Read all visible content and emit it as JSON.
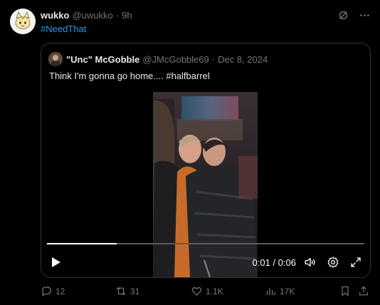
{
  "tweet": {
    "author_name": "wukko",
    "author_handle": "@uwukko",
    "separator": "·",
    "time": "9h",
    "text": "#NeedThat"
  },
  "quoted": {
    "author_name": "\"Unc\" McGobble",
    "author_handle": "@JMcGobble69",
    "separator": "·",
    "date": "Dec 8, 2024",
    "text": "Think I'm gonna go home.... #halfbarrel"
  },
  "video": {
    "time_display": "0:01 / 0:06",
    "progress": 0.22,
    "icons": [
      "play-icon",
      "volume-icon",
      "settings-icon",
      "fullscreen-icon"
    ]
  },
  "actions": {
    "replies": "12",
    "reposts": "31",
    "likes": "1.1K",
    "views": "17K"
  },
  "colors": {
    "background": "#000000",
    "text": "#e7e9ea",
    "muted": "#71767b",
    "link": "#1d9bf0",
    "border": "#2f3336"
  }
}
